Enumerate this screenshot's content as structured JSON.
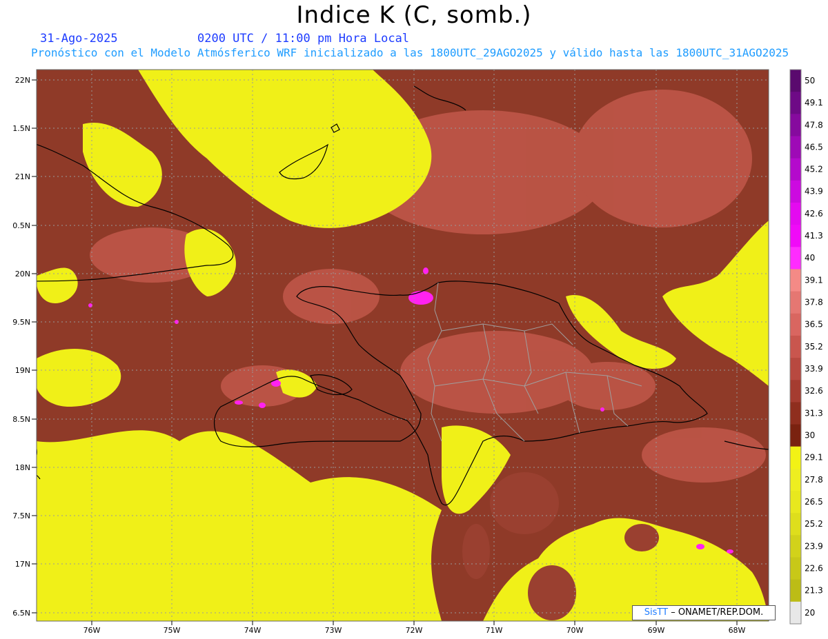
{
  "header": {
    "title": "Indice K (C, somb.)",
    "date": "31-Ago-2025",
    "time": "0200 UTC / 11:00 pm Hora Local",
    "model_info": "Pronóstico con el Modelo Atmósferico WRF inicializado a las 1800UTC_29AGO2025 y válido hasta las  1800UTC_31AGO2025"
  },
  "axes": {
    "lat_labels": [
      "22N",
      "1.5N",
      "21N",
      "0.5N",
      "20N",
      "9.5N",
      "19N",
      "8.5N",
      "18N",
      "7.5N",
      "17N",
      "6.5N"
    ],
    "lon_labels": [
      "76W",
      "75W",
      "74W",
      "73W",
      "72W",
      "71W",
      "70W",
      "69W",
      "68W"
    ]
  },
  "colorbar": {
    "levels": [
      "50",
      "49.1",
      "47.8",
      "46.5",
      "45.2",
      "43.9",
      "42.6",
      "41.3",
      "40",
      "39.1",
      "37.8",
      "36.5",
      "35.2",
      "33.9",
      "32.6",
      "31.3",
      "30",
      "29.1",
      "27.8",
      "26.5",
      "25.2",
      "23.9",
      "22.6",
      "21.3",
      "20"
    ],
    "colors": [
      "#5a0a6e",
      "#6e0a86",
      "#860a9e",
      "#9e0ab6",
      "#b40acc",
      "#cc0ae0",
      "#e40af0",
      "#f00af8",
      "#ff2cff",
      "#f48a86",
      "#e57772",
      "#d96660",
      "#c9564e",
      "#b84940",
      "#a53c30",
      "#8f2e1e",
      "#7a2210",
      "#f2f215",
      "#eeee20",
      "#e8e81e",
      "#dede1c",
      "#d2d21a",
      "#c8c818",
      "#bcbc16",
      "#e8e8e8"
    ]
  },
  "credit": {
    "brand": "SisTT",
    "text": " – ONAMET/REP.DOM."
  }
}
